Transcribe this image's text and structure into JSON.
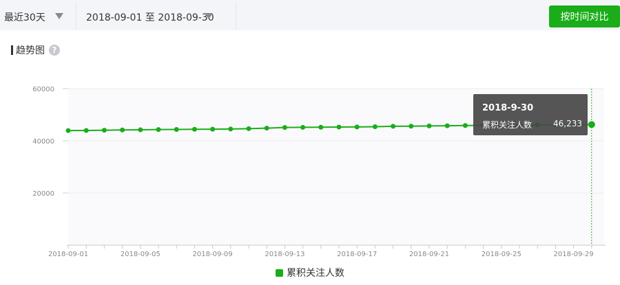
{
  "toolbar": {
    "range_label": "最近30天",
    "date_range_label": "2018-09-01 至 2018-09-30",
    "compare_button": "按时间对比"
  },
  "section": {
    "title": "趋势图",
    "help_icon_text": "?"
  },
  "legend": {
    "label": "累积关注人数"
  },
  "tooltip": {
    "date": "2018-9-30",
    "series": "累积关注人数",
    "value": "46,233"
  },
  "colors": {
    "accent": "#1aad19",
    "toolbar_bg": "#f4f5f9",
    "plot_bg": "#fafafc"
  },
  "chart_data": {
    "type": "line",
    "title": "",
    "xlabel": "",
    "ylabel": "",
    "ylim": [
      0,
      60000
    ],
    "y_ticks": [
      "20000",
      "40000",
      "60000"
    ],
    "x_tick_labels": [
      "2018-09-01",
      "2018-09-05",
      "2018-09-09",
      "2018-09-13",
      "2018-09-17",
      "2018-09-21",
      "2018-09-25",
      "2018-09-29"
    ],
    "x": [
      "2018-09-01",
      "2018-09-02",
      "2018-09-03",
      "2018-09-04",
      "2018-09-05",
      "2018-09-06",
      "2018-09-07",
      "2018-09-08",
      "2018-09-09",
      "2018-09-10",
      "2018-09-11",
      "2018-09-12",
      "2018-09-13",
      "2018-09-14",
      "2018-09-15",
      "2018-09-16",
      "2018-09-17",
      "2018-09-18",
      "2018-09-19",
      "2018-09-20",
      "2018-09-21",
      "2018-09-22",
      "2018-09-23",
      "2018-09-24",
      "2018-09-25",
      "2018-09-26",
      "2018-09-27",
      "2018-09-28",
      "2018-09-29",
      "2018-09-30"
    ],
    "series": [
      {
        "name": "累积关注人数",
        "values": [
          43900,
          43950,
          44050,
          44150,
          44200,
          44300,
          44350,
          44400,
          44450,
          44500,
          44650,
          44850,
          45100,
          45150,
          45200,
          45250,
          45300,
          45400,
          45550,
          45600,
          45700,
          45750,
          45850,
          45900,
          45950,
          46000,
          46050,
          46100,
          46150,
          46233
        ]
      }
    ],
    "grid": true,
    "legend_position": "bottom-center",
    "highlight_index": 29
  }
}
